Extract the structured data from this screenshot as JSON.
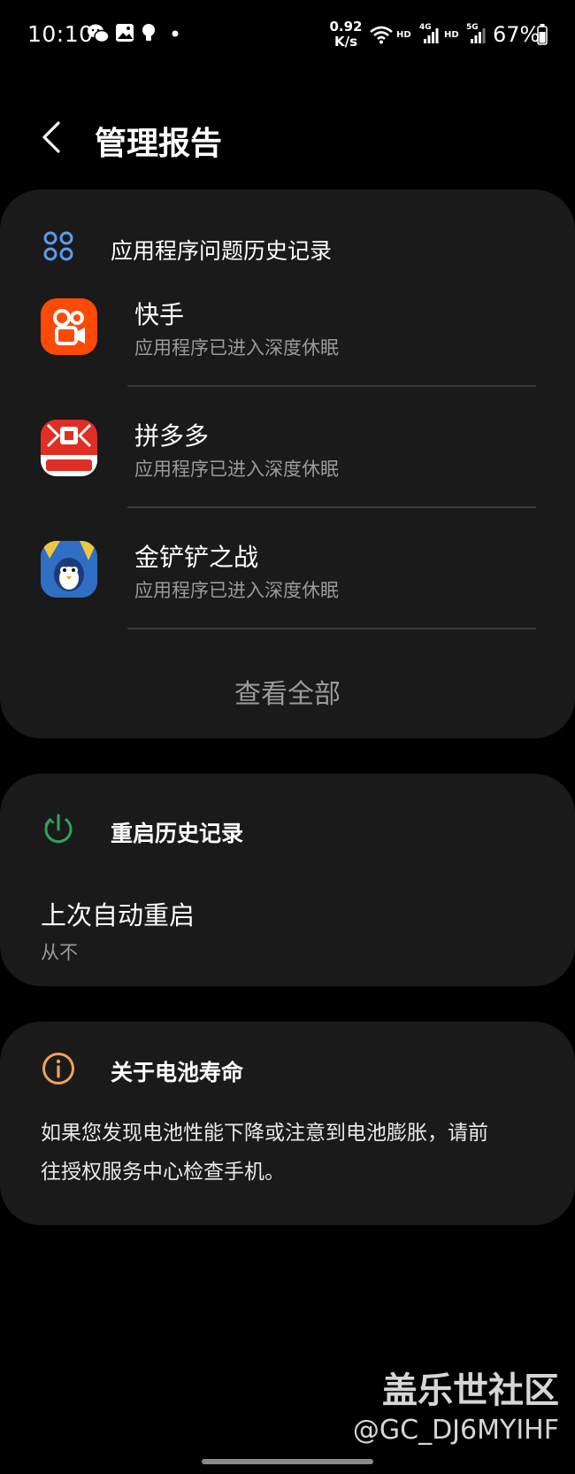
{
  "status_bar": {
    "time": "10:10",
    "speed_value": "0.92",
    "speed_unit": "K/s",
    "hd1": "HD",
    "net1": "4G",
    "hd2": "HD",
    "net2": "5G",
    "battery": "67%",
    "icons": [
      "wechat-icon",
      "gallery-icon",
      "bulb-icon",
      "dot-icon",
      "wifi-icon",
      "signal-icon",
      "signal-icon",
      "battery-icon"
    ]
  },
  "header": {
    "title": "管理报告"
  },
  "issues_card": {
    "title": "应用程序问题历史记录",
    "apps": [
      {
        "name": "快手",
        "status": "应用程序已进入深度休眠",
        "icon": "kuaishou-app-icon",
        "color": "#ff4906"
      },
      {
        "name": "拼多多",
        "status": "应用程序已进入深度休眠",
        "icon": "pinduoduo-app-icon",
        "color": "#e02e24"
      },
      {
        "name": "金铲铲之战",
        "status": "应用程序已进入深度休眠",
        "icon": "jcc-game-app-icon",
        "color": "#2f6fc4"
      }
    ],
    "view_all": "查看全部"
  },
  "restart_card": {
    "title": "重启历史记录",
    "last_label": "上次自动重启",
    "last_value": "从不"
  },
  "battery_card": {
    "title": "关于电池寿命",
    "body_line1": "如果您发现电池性能下降或注意到电池膨胀，请前",
    "body_line2": "往授权服务中心检查手机。"
  },
  "watermark": {
    "brand": "盖乐世社区",
    "user": "@GC_DJ6MYIHF"
  },
  "colors": {
    "background": "#000000",
    "card": "#1a1a1a",
    "secondary_text": "#9a9a9a",
    "accent_blue": "#5b9bf0",
    "accent_green": "#2fa45b",
    "accent_orange": "#f0a25a"
  }
}
